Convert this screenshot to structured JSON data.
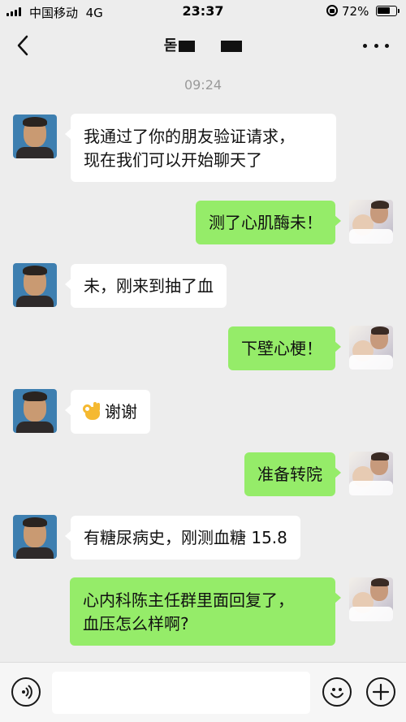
{
  "status_bar": {
    "carrier": "中国移动",
    "network": "4G",
    "time": "23:37",
    "battery_percent": "72%",
    "battery_level": 0.72
  },
  "nav": {
    "title": "돋",
    "back_icon": "chevron-left-icon",
    "more_icon": "more-horizontal-icon"
  },
  "time_divider": "09:24",
  "messages": [
    {
      "side": "in",
      "lines": [
        "我通过了你的朋友验证请求，",
        "现在我们可以开始聊天了"
      ]
    },
    {
      "side": "out",
      "lines": [
        "测了心肌酶未！"
      ]
    },
    {
      "side": "in",
      "lines": [
        "未，刚来到抽了血"
      ]
    },
    {
      "side": "out",
      "lines": [
        "下壁心梗！"
      ]
    },
    {
      "side": "in",
      "lines": [
        "谢谢"
      ],
      "emoji": "ok-hand-icon"
    },
    {
      "side": "out",
      "lines": [
        "准备转院"
      ]
    },
    {
      "side": "in",
      "lines": [
        "有糖尿病史，刚测血糖 15.8"
      ]
    },
    {
      "side": "out",
      "lines": [
        "心内科陈主任群里面回复了，",
        "血压怎么样啊?"
      ]
    }
  ],
  "input_bar": {
    "text_value": "",
    "voice_icon": "voice-icon",
    "emoji_icon": "emoji-icon",
    "add_icon": "plus-circle-icon"
  },
  "colors": {
    "background": "#ededed",
    "incoming_bubble": "#ffffff",
    "outgoing_bubble": "#95ec69"
  }
}
